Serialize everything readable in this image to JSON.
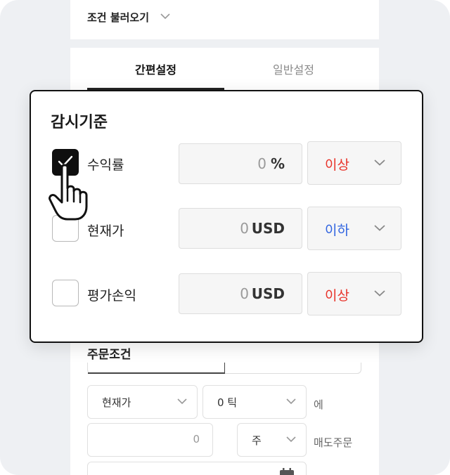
{
  "background": {
    "load_conditions": "조건 불러오기",
    "tabs": [
      {
        "label": "간편설정",
        "active": true
      },
      {
        "label": "일반설정",
        "active": false
      }
    ],
    "order": {
      "title": "주문조건",
      "price_type": "현재가",
      "tick": "0 틱",
      "tick_suffix": "에",
      "quantity": "0",
      "quantity_unit": "주",
      "action": "매도주문"
    }
  },
  "modal": {
    "title": "감시기준",
    "rows": [
      {
        "label": "수익률",
        "checked": true,
        "value": "0",
        "unit": "%",
        "comparison": "이상",
        "comparison_color": "#e8332a"
      },
      {
        "label": "현재가",
        "checked": false,
        "value": "0",
        "unit": "USD",
        "comparison": "이하",
        "comparison_color": "#2f63e0"
      },
      {
        "label": "평가손익",
        "checked": false,
        "value": "0",
        "unit": "USD",
        "comparison": "이상",
        "comparison_color": "#e8332a"
      }
    ]
  },
  "icons": {
    "chevron": "chevron-down-icon",
    "check": "check-icon",
    "pointer": "hand-pointer-icon",
    "calendar": "calendar-icon"
  },
  "colors": {
    "accent_up": "#e8332a",
    "accent_down": "#2f63e0",
    "checked_box": "#0f0f0f"
  }
}
